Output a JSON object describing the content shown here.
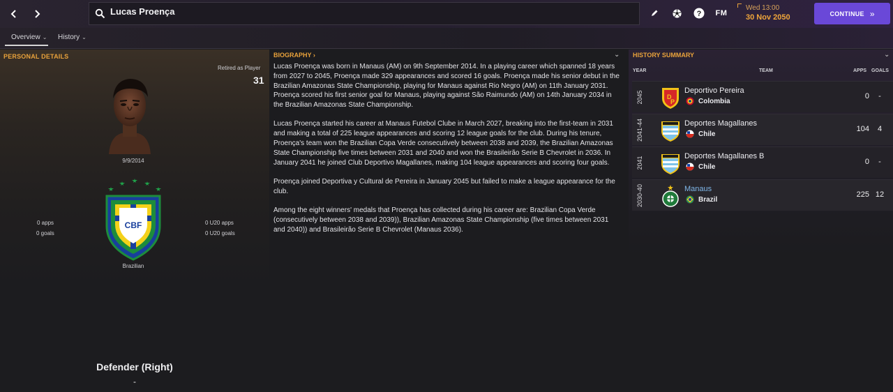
{
  "search": {
    "player_name": "Lucas Proença"
  },
  "topbar": {
    "date_day_time": "Wed 13:00",
    "date": "30 Nov 2050",
    "continue_label": "CONTINUE",
    "fm_label": "FM"
  },
  "tabs": [
    {
      "label": "Overview"
    },
    {
      "label": "History"
    }
  ],
  "personal": {
    "title": "PERSONAL DETAILS",
    "retired_label": "Retired as Player",
    "retired_age": "31",
    "dob": "9/9/2014",
    "apps": "0 apps",
    "goals": "0 goals",
    "u20_apps": "0 U20 apps",
    "u20_goals": "0 U20 goals",
    "nationality": "Brazilian",
    "badge_text": "CBF",
    "position": "Defender (Right)",
    "position_sub": "-"
  },
  "biography": {
    "title": "BIOGRAPHY",
    "paragraphs": [
      "Lucas Proença was born in Manaus (AM) on 9th September 2014. In a playing career which spanned 18 years from 2027 to 2045, Proença made 329 appearances and scored 16 goals. Proença made his senior debut in the Brazilian Amazonas State Championship, playing for Manaus against Rio Negro (AM) on 11th January 2031. Proença scored his first senior goal for Manaus, playing against São Raimundo (AM) on 14th January 2034 in the Brazilian Amazonas State Championship.",
      "Lucas Proença started his career at Manaus Futebol Clube in March 2027, breaking into the first-team in 2031 and making a total of 225 league appearances and scoring 12 league goals for the club. During his tenure, Proença's team won the Brazilian Copa Verde consecutively between 2038 and 2039, the Brazilian Amazonas State Championship five times between 2031 and 2040 and won the Brasileirão Serie B Chevrolet in 2036. In January 2041 he joined Club Deportivo Magallanes, making 104 league appearances and scoring four goals.",
      "Proença joined Deportiva y Cultural de Pereira in January 2045 but failed to make a league appearance for the club.",
      "Among the eight winners' medals that Proença has collected during his career are: Brazilian Copa Verde (consecutively between 2038 and 2039)), Brazilian Amazonas State Championship (five times between 2031 and 2040)) and Brasileirão Serie B Chevrolet (Manaus 2036)."
    ]
  },
  "history": {
    "title": "HISTORY SUMMARY",
    "columns": {
      "year": "YEAR",
      "team": "TEAM",
      "apps": "APPS",
      "goals": "GOALS"
    },
    "rows": [
      {
        "year": "2045",
        "team": "Deportivo Pereira",
        "nation": "Colombia",
        "apps": "0",
        "goals": "-",
        "logo": "pereira-logo-icon",
        "flag": "colombia-flag-icon"
      },
      {
        "year": "2041-44",
        "team": "Deportes Magallanes",
        "nation": "Chile",
        "apps": "104",
        "goals": "4",
        "logo": "magallanes-logo-icon",
        "flag": "chile-flag-icon"
      },
      {
        "year": "2041",
        "team": "Deportes Magallanes B",
        "nation": "Chile",
        "apps": "0",
        "goals": "-",
        "logo": "magallanes-logo-icon",
        "flag": "chile-flag-icon"
      },
      {
        "year": "2030-40",
        "team": "Manaus",
        "nation": "Brazil",
        "apps": "225",
        "goals": "12",
        "logo": "manaus-logo-icon",
        "flag": "brazil-flag-icon"
      }
    ]
  },
  "colors": {
    "accent_orange": "#e9a23b",
    "continue_purple": "#6a48d8",
    "link_blue": "#7fb6e8"
  }
}
